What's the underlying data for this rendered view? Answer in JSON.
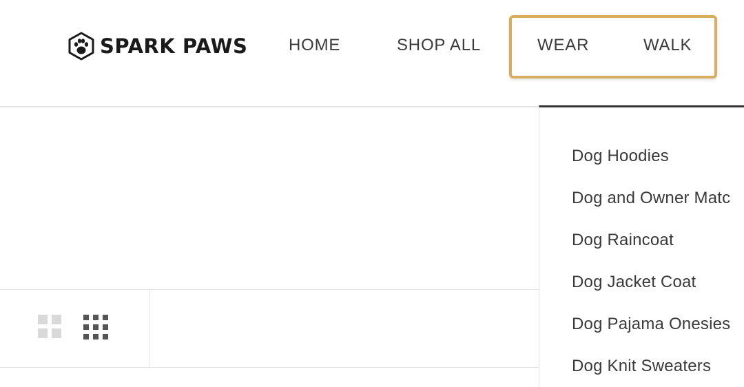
{
  "header": {
    "brand": "SPARK PAWS",
    "logo_icon": "paw-hexagon-icon",
    "nav": [
      {
        "label": "HOME"
      },
      {
        "label": "SHOP ALL"
      },
      {
        "label": "WEAR"
      },
      {
        "label": "WALK"
      }
    ]
  },
  "colors": {
    "highlight": "#d9ad5f",
    "text": "#3a3a3a",
    "dropdown_border": "#333333",
    "divider": "#e2e2e2"
  },
  "toolbar": {
    "view_options": [
      {
        "icon": "grid-2x2-icon",
        "active": false
      },
      {
        "icon": "grid-3x3-icon",
        "active": true
      }
    ]
  },
  "dropdown": {
    "items": [
      {
        "label": "Dog Hoodies"
      },
      {
        "label": "Dog and Owner Matc"
      },
      {
        "label": "Dog Raincoat"
      },
      {
        "label": "Dog Jacket Coat"
      },
      {
        "label": "Dog Pajama Onesies"
      },
      {
        "label": "Dog Knit Sweaters"
      }
    ]
  }
}
